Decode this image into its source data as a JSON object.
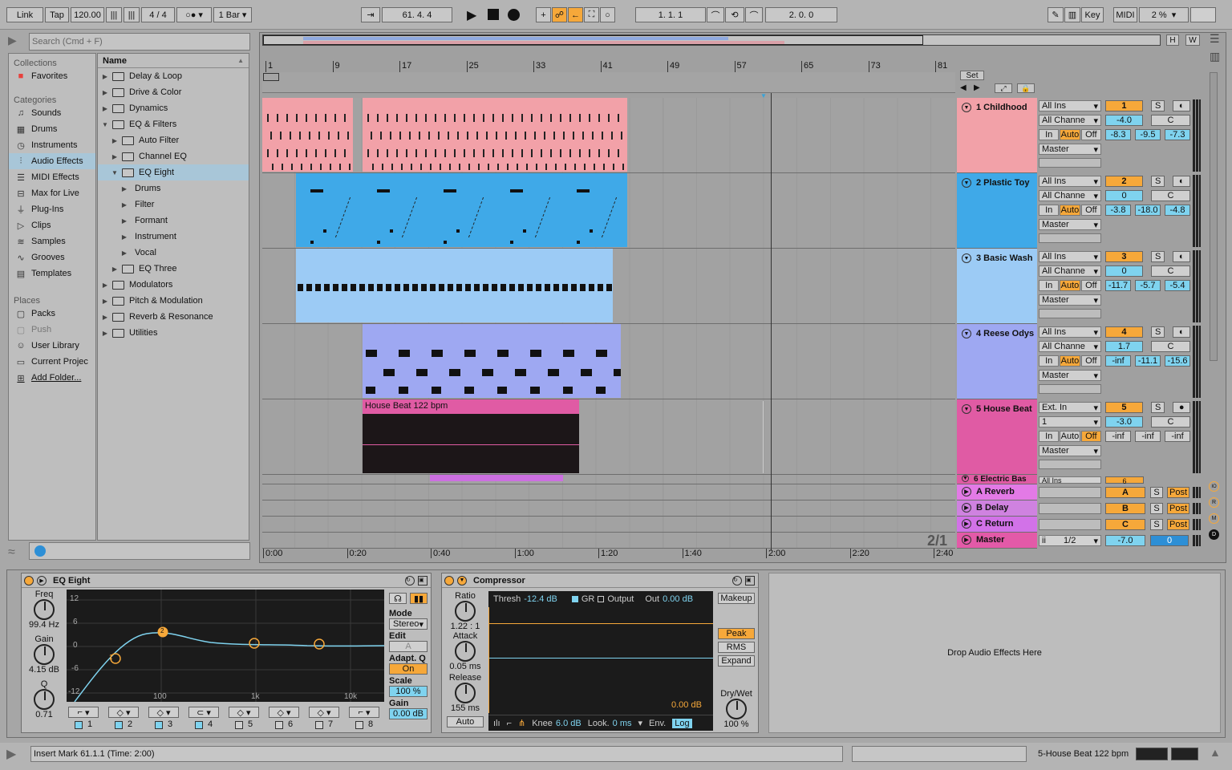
{
  "topbar": {
    "link": "Link",
    "tap": "Tap",
    "tempo": "120.00",
    "signature": "4 / 4",
    "quant": "1 Bar",
    "position": "61.   4.   4",
    "loop_start": "1.   1.   1",
    "loop_length": "2.   0.   0",
    "key": "Key",
    "midi": "MIDI",
    "cpu": "2 %"
  },
  "browser": {
    "search_placeholder": "Search (Cmd + F)",
    "collections_label": "Collections",
    "favorites": "Favorites",
    "categories_label": "Categories",
    "categories": [
      "Sounds",
      "Drums",
      "Instruments",
      "Audio Effects",
      "MIDI Effects",
      "Max for Live",
      "Plug-Ins",
      "Clips",
      "Samples",
      "Grooves",
      "Templates"
    ],
    "places_label": "Places",
    "places": [
      "Packs",
      "Push",
      "User Library",
      "Current Projec",
      "Add Folder..."
    ],
    "name_header": "Name",
    "tree": [
      "Delay & Loop",
      "Drive & Color",
      "Dynamics",
      "EQ & Filters",
      "Auto Filter",
      "Channel EQ",
      "EQ Eight",
      "Drums",
      "Filter",
      "Formant",
      "Instrument",
      "Vocal",
      "EQ Three",
      "Modulators",
      "Pitch & Modulation",
      "Reverb & Resonance",
      "Utilities"
    ]
  },
  "arrangement": {
    "bars": [
      "1",
      "9",
      "17",
      "25",
      "33",
      "41",
      "49",
      "57",
      "65",
      "73",
      "81"
    ],
    "times": [
      "0:00",
      "0:20",
      "0:40",
      "1:00",
      "1:20",
      "1:40",
      "2:00",
      "2:20",
      "2:40"
    ],
    "set_label": "Set",
    "zoom_label": "2/1",
    "clip_house": "House Beat 122 bpm"
  },
  "tracks": [
    {
      "name": "1 Childhood",
      "color": "#f2a1a8",
      "input": "All Ins",
      "channel": "All Channe",
      "num": "1",
      "vol": "-4.0",
      "pan": "C",
      "m1": "-8.3",
      "m2": "-9.5",
      "m3": "-7.3"
    },
    {
      "name": "2 Plastic Toy",
      "color": "#3fa9e8",
      "input": "All Ins",
      "channel": "All Channe",
      "num": "2",
      "vol": "0",
      "pan": "C",
      "m1": "-3.8",
      "m2": "-18.0",
      "m3": "-4.8"
    },
    {
      "name": "3 Basic Wash",
      "color": "#9ccbf5",
      "input": "All Ins",
      "channel": "All Channe",
      "num": "3",
      "vol": "0",
      "pan": "C",
      "m1": "-11.7",
      "m2": "-5.7",
      "m3": "-5.4"
    },
    {
      "name": "4 Reese Odys",
      "color": "#9ea8f2",
      "input": "All Ins",
      "channel": "All Channe",
      "num": "4",
      "vol": "1.7",
      "pan": "C",
      "m1": "-inf",
      "m2": "-11.1",
      "m3": "-15.6"
    },
    {
      "name": "5 House Beat",
      "color": "#e05ba4",
      "input": "Ext. In",
      "channel": "1",
      "num": "5",
      "vol": "-3.0",
      "pan": "C",
      "m1": "-inf",
      "m2": "-inf",
      "m3": "-inf"
    }
  ],
  "track6": {
    "name": "6 Electric Bas",
    "input": "All Ins",
    "num": "6"
  },
  "io_labels": {
    "in": "In",
    "auto": "Auto",
    "off": "Off",
    "master": "Master",
    "solo": "S"
  },
  "returns": [
    {
      "name": "A Reverb",
      "letter": "A",
      "post": "Post"
    },
    {
      "name": "B Delay",
      "letter": "B",
      "post": "Post"
    },
    {
      "name": "C Return",
      "letter": "C",
      "post": "Post"
    }
  ],
  "master": {
    "name": "Master",
    "cue": "1/2",
    "vol": "-7.0",
    "pan": "0"
  },
  "eq": {
    "title": "EQ Eight",
    "freq_label": "Freq",
    "freq": "99.4 Hz",
    "gain_label": "Gain",
    "gain": "4.15 dB",
    "q_label": "Q",
    "q": "0.71",
    "db_ticks": [
      "12",
      "6",
      "0",
      "-6",
      "-12"
    ],
    "freq_ticks": [
      "100",
      "1k",
      "10k"
    ],
    "mode_label": "Mode",
    "mode": "Stereo",
    "edit_label": "Edit",
    "edit": "A",
    "adapt_label": "Adapt. Q",
    "adapt": "On",
    "scale_label": "Scale",
    "scale": "100 %",
    "gain_out_label": "Gain",
    "gain_out": "0.00 dB",
    "bands": [
      "1",
      "2",
      "3",
      "4",
      "5",
      "6",
      "7",
      "8"
    ]
  },
  "comp": {
    "title": "Compressor",
    "ratio_label": "Ratio",
    "ratio": "1.22 : 1",
    "attack_label": "Attack",
    "attack": "0.05 ms",
    "release_label": "Release",
    "release": "155 ms",
    "auto": "Auto",
    "thresh_label": "Thresh",
    "thresh": "-12.4 dB",
    "gr": "GR",
    "output": "Output",
    "out_label": "Out",
    "out": "0.00 dB",
    "makeup": "Makeup",
    "graph_db": "0.00 dB",
    "peak": "Peak",
    "rms": "RMS",
    "expand": "Expand",
    "knee_label": "Knee",
    "knee": "6.0 dB",
    "look_label": "Look.",
    "look": "0 ms",
    "env_label": "Env.",
    "env": "Log",
    "drywet_label": "Dry/Wet",
    "drywet": "100 %"
  },
  "drop_hint": "Drop Audio Effects Here",
  "status": {
    "message": "Insert Mark 61.1.1 (Time: 2:00)",
    "clip": "5-House Beat 122 bpm"
  },
  "colors": {
    "orange": "#f6a83a",
    "blue": "#7fd3ef",
    "selection": "#a8c6d8"
  }
}
